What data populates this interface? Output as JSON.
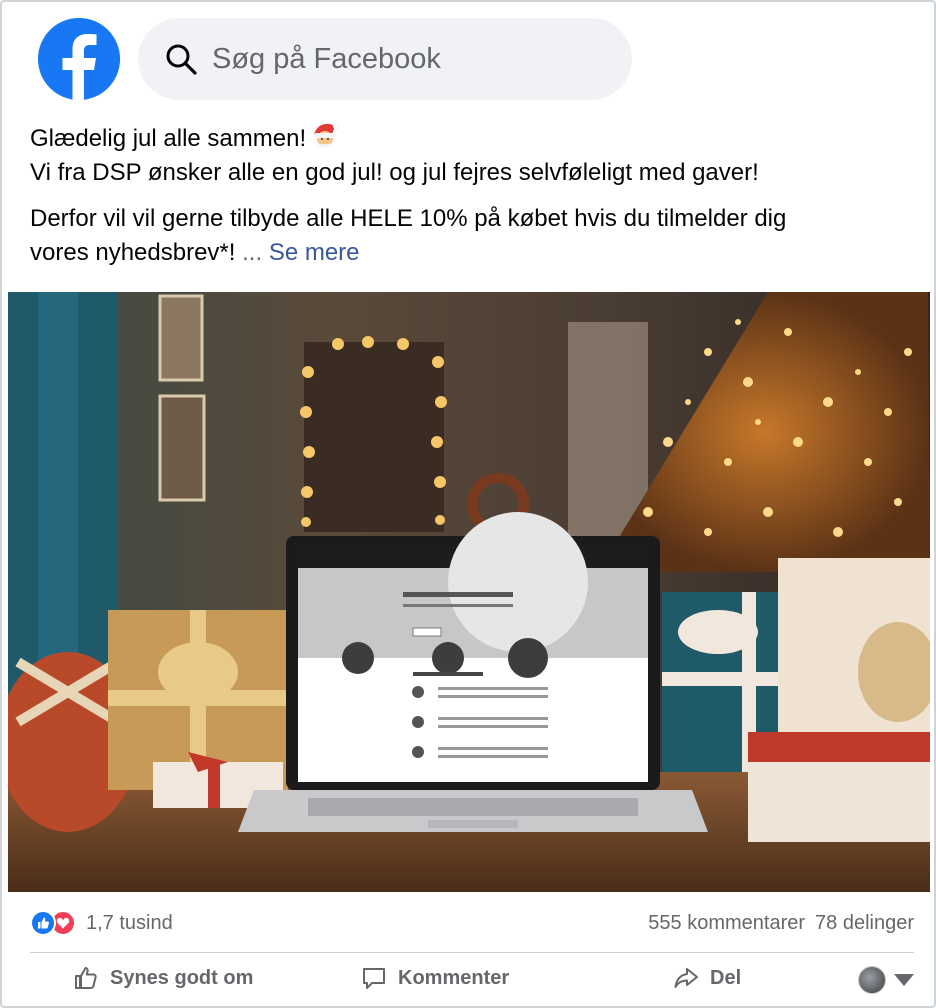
{
  "search": {
    "placeholder": "Søg på Facebook"
  },
  "post": {
    "line1": "Glædelig jul alle sammen!",
    "line2": "Vi fra DSP ønsker alle en god jul! og jul fejres selvføleligt med gaver!",
    "line3": "Derfor vil vil gerne tilbyde alle HELE 10% på købet hvis du tilmelder dig",
    "line4": "vores nyhedsbrev*!",
    "ellipsis": "...",
    "see_more": "Se mere"
  },
  "stats": {
    "reaction_count": "1,7 tusind",
    "comments": "555 kommentarer",
    "shares": "78 delinger"
  },
  "actions": {
    "like": "Synes godt om",
    "comment": "Kommenter",
    "share": "Del"
  },
  "colors": {
    "brand": "#1877f2",
    "love": "#f33e58",
    "link": "#385898",
    "muted": "#65676b"
  }
}
